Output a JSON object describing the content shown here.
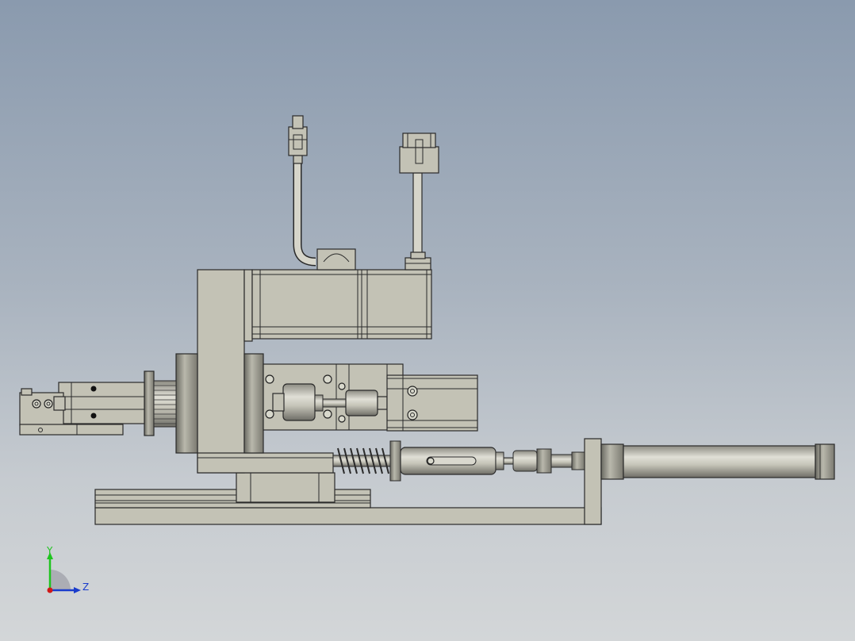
{
  "viewport": {
    "background_top": "#8a9aae",
    "background_bottom": "#d3d6d8",
    "part_color": "#c3c2b5",
    "edge_color": "#2a2a2a"
  },
  "triad": {
    "y_label": "Y",
    "z_label": "Z",
    "y_color": "#1fc41f",
    "z_color": "#1a3ccc",
    "x_color": "#d01818"
  }
}
